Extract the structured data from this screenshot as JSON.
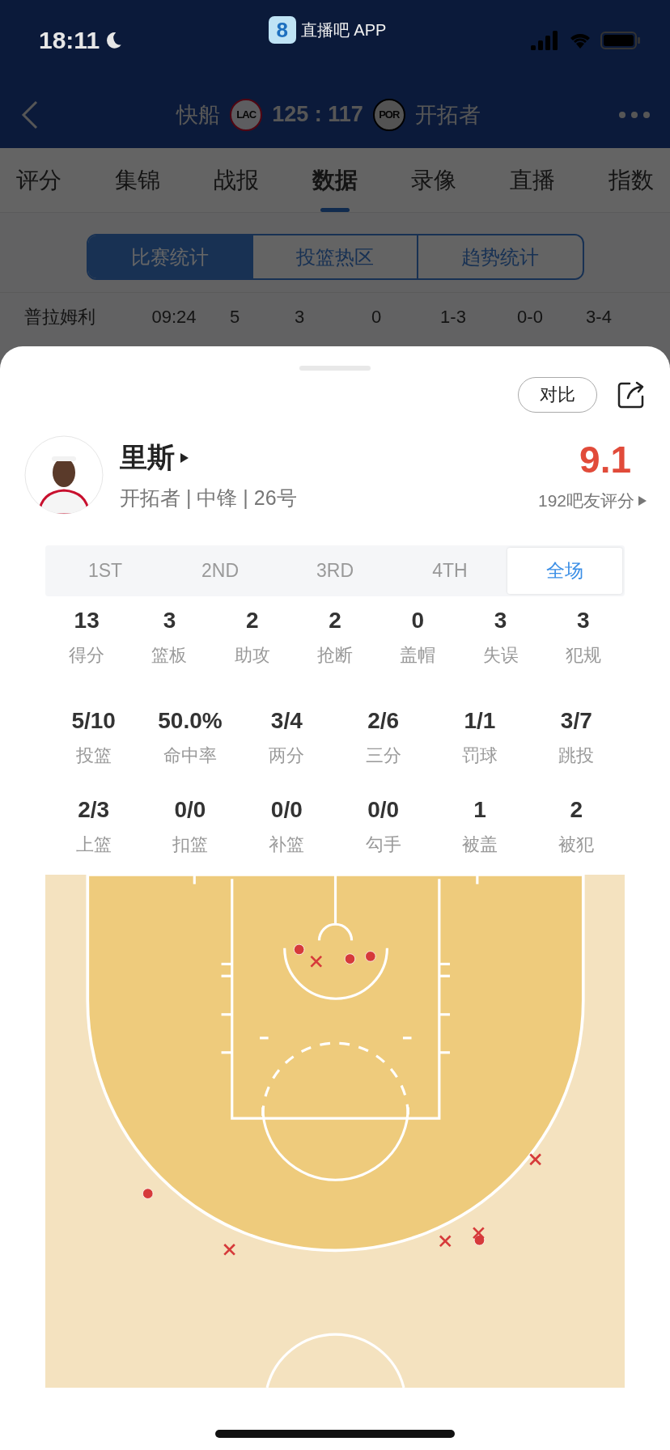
{
  "status_bar": {
    "time": "18:11"
  },
  "app_banner": {
    "badge": "8",
    "label": "直播吧 APP"
  },
  "match_header": {
    "home_team": "快船",
    "home_logo": "LAC",
    "score": "125 : 117",
    "away_logo": "POR",
    "away_team": "开拓者"
  },
  "tabs": [
    {
      "label": "评分",
      "selected": false
    },
    {
      "label": "集锦",
      "selected": false
    },
    {
      "label": "战报",
      "selected": false
    },
    {
      "label": "数据",
      "selected": true
    },
    {
      "label": "录像",
      "selected": false
    },
    {
      "label": "直播",
      "selected": false
    },
    {
      "label": "指数",
      "selected": false
    }
  ],
  "segments": [
    {
      "label": "比赛统计",
      "selected": true
    },
    {
      "label": "投篮热区",
      "selected": false
    },
    {
      "label": "趋势统计",
      "selected": false
    }
  ],
  "background_row": [
    "普拉姆利",
    "09:24",
    "5",
    "3",
    "0",
    "1-3",
    "0-0",
    "3-4"
  ],
  "player_sheet": {
    "compare_button": "对比",
    "name": "里斯",
    "info": "开拓者 | 中锋 | 26号",
    "rating": "9.1",
    "rating_count": "192吧友评分",
    "periods": [
      {
        "label": "1ST",
        "selected": false
      },
      {
        "label": "2ND",
        "selected": false
      },
      {
        "label": "3RD",
        "selected": false
      },
      {
        "label": "4TH",
        "selected": false
      },
      {
        "label": "全场",
        "selected": true
      }
    ],
    "stat_rows": [
      [
        {
          "value": "13",
          "label": "得分"
        },
        {
          "value": "3",
          "label": "篮板"
        },
        {
          "value": "2",
          "label": "助攻"
        },
        {
          "value": "2",
          "label": "抢断"
        },
        {
          "value": "0",
          "label": "盖帽"
        },
        {
          "value": "3",
          "label": "失误"
        },
        {
          "value": "3",
          "label": "犯规"
        }
      ],
      [
        {
          "value": "5/10",
          "label": "投篮"
        },
        {
          "value": "50.0%",
          "label": "命中率"
        },
        {
          "value": "3/4",
          "label": "两分"
        },
        {
          "value": "2/6",
          "label": "三分"
        },
        {
          "value": "1/1",
          "label": "罚球"
        },
        {
          "value": "3/7",
          "label": "跳投"
        }
      ],
      [
        {
          "value": "2/3",
          "label": "上篮"
        },
        {
          "value": "0/0",
          "label": "扣篮"
        },
        {
          "value": "0/0",
          "label": "补篮"
        },
        {
          "value": "0/0",
          "label": "勾手"
        },
        {
          "value": "1",
          "label": "被盖"
        },
        {
          "value": "2",
          "label": "被犯"
        }
      ]
    ]
  }
}
